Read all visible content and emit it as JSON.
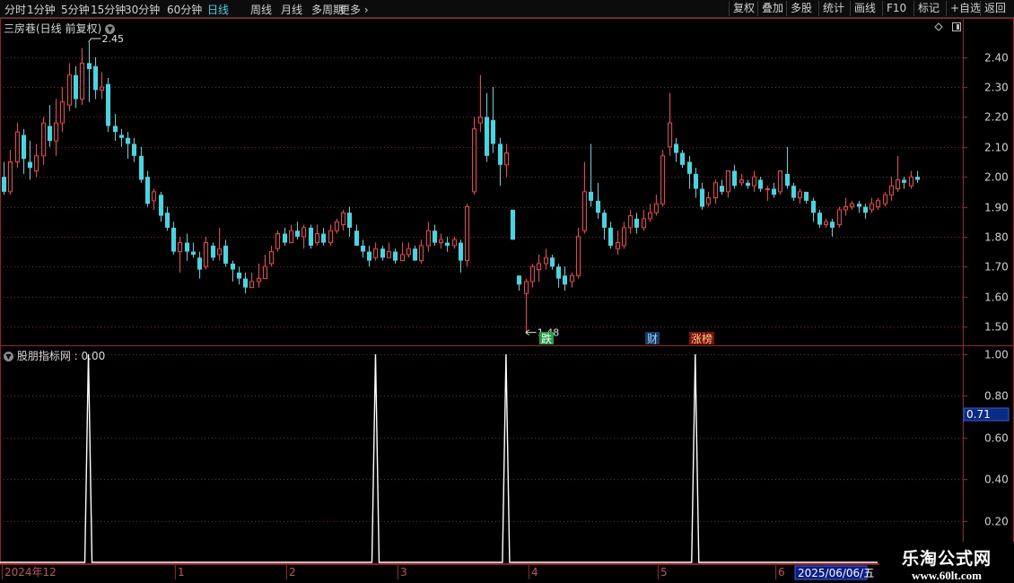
{
  "toolbar": {
    "periods": [
      "分时",
      "1分钟",
      "5分钟",
      "15分钟",
      "30分钟",
      "60分钟",
      "日线",
      "周线",
      "月线",
      "多周期",
      "更多"
    ],
    "buttons": [
      "复权",
      "叠加",
      "多股",
      "统计",
      "画线",
      "F10",
      "标记",
      "+自选",
      "返回"
    ]
  },
  "main_panel": {
    "title": "三房巷(日线 前复权)",
    "tag_labels": [
      "跌",
      "财",
      "涨榜"
    ]
  },
  "indicator_panel": {
    "title": "股朋指标网 : 0.00"
  },
  "date_axis": {
    "labels": [
      "2024年12",
      "1",
      "2",
      "3",
      "4",
      "5",
      "6"
    ],
    "cursor_date": "2025/06/06/五"
  },
  "price_axis_labels": [
    "2.40",
    "2.30",
    "2.20",
    "2.10",
    "2.00",
    "1.90",
    "1.80",
    "1.70",
    "1.60",
    "1.50"
  ],
  "indicator_axis_labels": [
    "1.00",
    "0.80",
    "0.60",
    "0.40",
    "0.20"
  ],
  "indicator_cursor_value": "0.71",
  "watermark": {
    "line1": "乐淘公式网",
    "line2": "www.60lt.com"
  },
  "colors": {
    "up": "#ff3a3a",
    "down": "#3fd8e6",
    "grid": "#8b1a1a",
    "frame": "#a01c1c",
    "indicator": "#ffffff"
  },
  "chart_data": {
    "type": "candlestick",
    "price_ylim": [
      1.44,
      2.48
    ],
    "high_marker": "2.45",
    "low_marker": "1.48",
    "candles": [
      [
        2.0,
        1.95,
        2.05,
        1.94
      ],
      [
        1.95,
        2.05,
        2.09,
        1.94
      ],
      [
        2.05,
        2.15,
        2.18,
        2.03
      ],
      [
        2.14,
        2.06,
        2.16,
        2.01
      ],
      [
        2.05,
        2.03,
        2.12,
        1.99
      ],
      [
        2.02,
        2.07,
        2.11,
        2.0
      ],
      [
        2.07,
        2.18,
        2.2,
        2.04
      ],
      [
        2.17,
        2.12,
        2.24,
        2.1
      ],
      [
        2.12,
        2.18,
        2.26,
        2.07
      ],
      [
        2.18,
        2.25,
        2.3,
        2.15
      ],
      [
        2.24,
        2.34,
        2.38,
        2.22
      ],
      [
        2.34,
        2.26,
        2.37,
        2.23
      ],
      [
        2.26,
        2.38,
        2.43,
        2.24
      ],
      [
        2.38,
        2.36,
        2.45,
        2.25
      ],
      [
        2.37,
        2.29,
        2.4,
        2.26
      ],
      [
        2.29,
        2.3,
        2.35,
        2.26
      ],
      [
        2.31,
        2.17,
        2.33,
        2.15
      ],
      [
        2.17,
        2.15,
        2.21,
        2.12
      ],
      [
        2.14,
        2.13,
        2.16,
        2.1
      ],
      [
        2.13,
        2.11,
        2.15,
        2.06
      ],
      [
        2.11,
        2.07,
        2.13,
        2.05
      ],
      [
        2.07,
        1.99,
        2.1,
        1.98
      ],
      [
        2.0,
        1.91,
        2.02,
        1.9
      ],
      [
        1.92,
        1.95,
        1.96,
        1.89
      ],
      [
        1.94,
        1.87,
        1.95,
        1.85
      ],
      [
        1.88,
        1.83,
        1.9,
        1.82
      ],
      [
        1.83,
        1.75,
        1.85,
        1.74
      ],
      [
        1.75,
        1.78,
        1.8,
        1.68
      ],
      [
        1.78,
        1.75,
        1.81,
        1.72
      ],
      [
        1.75,
        1.74,
        1.78,
        1.73
      ],
      [
        1.73,
        1.69,
        1.75,
        1.66
      ],
      [
        1.7,
        1.78,
        1.8,
        1.69
      ],
      [
        1.77,
        1.73,
        1.78,
        1.72
      ],
      [
        1.74,
        1.76,
        1.83,
        1.72
      ],
      [
        1.77,
        1.71,
        1.79,
        1.7
      ],
      [
        1.71,
        1.69,
        1.72,
        1.65
      ],
      [
        1.68,
        1.66,
        1.7,
        1.64
      ],
      [
        1.66,
        1.63,
        1.68,
        1.61
      ],
      [
        1.63,
        1.65,
        1.68,
        1.63
      ],
      [
        1.65,
        1.66,
        1.71,
        1.63
      ],
      [
        1.66,
        1.7,
        1.74,
        1.66
      ],
      [
        1.71,
        1.75,
        1.77,
        1.7
      ],
      [
        1.76,
        1.81,
        1.82,
        1.75
      ],
      [
        1.81,
        1.78,
        1.83,
        1.77
      ],
      [
        1.78,
        1.82,
        1.84,
        1.78
      ],
      [
        1.82,
        1.8,
        1.85,
        1.79
      ],
      [
        1.8,
        1.83,
        1.84,
        1.76
      ],
      [
        1.83,
        1.77,
        1.84,
        1.76
      ],
      [
        1.78,
        1.81,
        1.84,
        1.77
      ],
      [
        1.81,
        1.78,
        1.83,
        1.77
      ],
      [
        1.78,
        1.82,
        1.84,
        1.77
      ],
      [
        1.82,
        1.85,
        1.86,
        1.81
      ],
      [
        1.84,
        1.88,
        1.89,
        1.82
      ],
      [
        1.88,
        1.83,
        1.9,
        1.8
      ],
      [
        1.82,
        1.77,
        1.84,
        1.77
      ],
      [
        1.77,
        1.75,
        1.79,
        1.73
      ],
      [
        1.75,
        1.72,
        1.77,
        1.7
      ],
      [
        1.73,
        1.76,
        1.78,
        1.72
      ],
      [
        1.76,
        1.73,
        1.77,
        1.72
      ],
      [
        1.73,
        1.75,
        1.78,
        1.73
      ],
      [
        1.75,
        1.72,
        1.76,
        1.71
      ],
      [
        1.72,
        1.74,
        1.78,
        1.72
      ],
      [
        1.74,
        1.76,
        1.78,
        1.73
      ],
      [
        1.76,
        1.72,
        1.77,
        1.72
      ],
      [
        1.72,
        1.77,
        1.79,
        1.71
      ],
      [
        1.77,
        1.82,
        1.85,
        1.75
      ],
      [
        1.82,
        1.78,
        1.84,
        1.77
      ],
      [
        1.78,
        1.79,
        1.81,
        1.76
      ],
      [
        1.78,
        1.77,
        1.8,
        1.75
      ],
      [
        1.77,
        1.79,
        1.8,
        1.76
      ],
      [
        1.78,
        1.72,
        1.79,
        1.68
      ],
      [
        1.72,
        1.9,
        1.91,
        1.7
      ],
      [
        1.95,
        2.16,
        2.2,
        1.94
      ],
      [
        2.18,
        2.2,
        2.34,
        2.15
      ],
      [
        2.2,
        2.07,
        2.28,
        2.05
      ],
      [
        2.19,
        2.11,
        2.3,
        2.08
      ],
      [
        2.11,
        2.04,
        2.13,
        1.97
      ],
      [
        2.04,
        2.08,
        2.11,
        2.0
      ],
      [
        1.89,
        1.79,
        1.89,
        1.79
      ],
      [
        1.67,
        1.64,
        1.67,
        1.62
      ],
      [
        1.61,
        1.65,
        1.66,
        1.48
      ],
      [
        1.65,
        1.7,
        1.71,
        1.63
      ],
      [
        1.69,
        1.71,
        1.74,
        1.65
      ],
      [
        1.71,
        1.73,
        1.76,
        1.69
      ],
      [
        1.73,
        1.7,
        1.74,
        1.69
      ],
      [
        1.7,
        1.66,
        1.71,
        1.63
      ],
      [
        1.67,
        1.64,
        1.7,
        1.62
      ],
      [
        1.65,
        1.67,
        1.68,
        1.63
      ],
      [
        1.67,
        1.8,
        1.83,
        1.66
      ],
      [
        1.82,
        1.95,
        2.05,
        1.81
      ],
      [
        1.95,
        1.92,
        2.11,
        1.9
      ],
      [
        1.92,
        1.88,
        1.98,
        1.86
      ],
      [
        1.88,
        1.83,
        1.89,
        1.79
      ],
      [
        1.83,
        1.77,
        1.85,
        1.76
      ],
      [
        1.76,
        1.78,
        1.82,
        1.74
      ],
      [
        1.77,
        1.83,
        1.85,
        1.76
      ],
      [
        1.83,
        1.87,
        1.89,
        1.81
      ],
      [
        1.86,
        1.83,
        1.88,
        1.81
      ],
      [
        1.83,
        1.86,
        1.89,
        1.82
      ],
      [
        1.86,
        1.88,
        1.91,
        1.85
      ],
      [
        1.88,
        1.91,
        1.94,
        1.87
      ],
      [
        1.91,
        2.07,
        2.09,
        1.9
      ],
      [
        2.1,
        2.18,
        2.28,
        2.07
      ],
      [
        2.11,
        2.08,
        2.13,
        2.05
      ],
      [
        2.08,
        2.04,
        2.09,
        2.03
      ],
      [
        2.05,
        2.01,
        2.07,
        1.96
      ],
      [
        2.01,
        1.96,
        2.03,
        1.93
      ],
      [
        1.96,
        1.9,
        1.98,
        1.89
      ],
      [
        1.91,
        1.93,
        1.95,
        1.9
      ],
      [
        1.93,
        1.98,
        1.99,
        1.91
      ],
      [
        1.97,
        1.95,
        1.99,
        1.94
      ],
      [
        1.95,
        2.02,
        2.02,
        1.93
      ],
      [
        2.02,
        1.97,
        2.04,
        1.96
      ],
      [
        1.98,
        1.99,
        2.01,
        1.97
      ],
      [
        1.98,
        1.97,
        1.99,
        1.96
      ],
      [
        1.97,
        2.0,
        2.02,
        1.95
      ],
      [
        1.99,
        1.96,
        2.0,
        1.95
      ],
      [
        1.96,
        1.96,
        1.97,
        1.92
      ],
      [
        1.96,
        1.94,
        1.98,
        1.93
      ],
      [
        1.95,
        2.02,
        2.02,
        1.94
      ],
      [
        2.01,
        1.97,
        2.1,
        1.96
      ],
      [
        1.97,
        1.93,
        1.98,
        1.92
      ],
      [
        1.93,
        1.95,
        1.96,
        1.91
      ],
      [
        1.95,
        1.92,
        1.95,
        1.91
      ],
      [
        1.92,
        1.88,
        1.93,
        1.85
      ],
      [
        1.88,
        1.84,
        1.89,
        1.83
      ],
      [
        1.84,
        1.85,
        1.86,
        1.83
      ],
      [
        1.85,
        1.83,
        1.86,
        1.8
      ],
      [
        1.84,
        1.89,
        1.9,
        1.83
      ],
      [
        1.89,
        1.9,
        1.93,
        1.87
      ],
      [
        1.9,
        1.91,
        1.92,
        1.89
      ],
      [
        1.91,
        1.9,
        1.92,
        1.88
      ],
      [
        1.9,
        1.88,
        1.91,
        1.86
      ],
      [
        1.89,
        1.91,
        1.93,
        1.88
      ],
      [
        1.9,
        1.92,
        1.93,
        1.89
      ],
      [
        1.91,
        1.94,
        1.95,
        1.9
      ],
      [
        1.94,
        1.97,
        2.0,
        1.92
      ],
      [
        1.96,
        1.99,
        2.07,
        1.95
      ],
      [
        1.99,
        1.98,
        2.0,
        1.96
      ],
      [
        1.97,
        2.0,
        2.02,
        1.96
      ],
      [
        2.0,
        1.99,
        2.02,
        1.98
      ]
    ],
    "indicator": {
      "ylim": [
        0,
        1.03
      ],
      "spike_indices": [
        13,
        57,
        77,
        106
      ],
      "spike_value": 1.0,
      "baseline": 0
    }
  }
}
